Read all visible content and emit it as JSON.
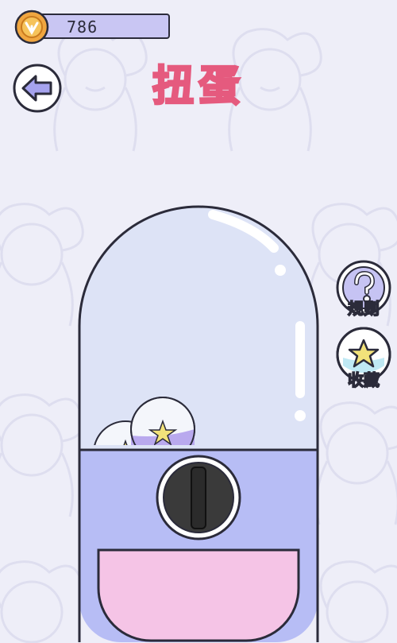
{
  "coins": {
    "value": "786"
  },
  "title": "扭蛋",
  "side_buttons": {
    "rules_label": "规则",
    "collection_label": "收藏"
  },
  "colors": {
    "background": "#eeeef8",
    "title_fill": "#f8e36a",
    "title_stroke": "#e55a7e",
    "machine_base": "#b7bdf5",
    "dome": "#dde3f6",
    "tray": "#f5c4e6",
    "coin": "#f0a640",
    "outline": "#2b2b3a"
  },
  "icons": [
    "coin-icon",
    "back-arrow-icon",
    "question-icon",
    "star-icon"
  ]
}
